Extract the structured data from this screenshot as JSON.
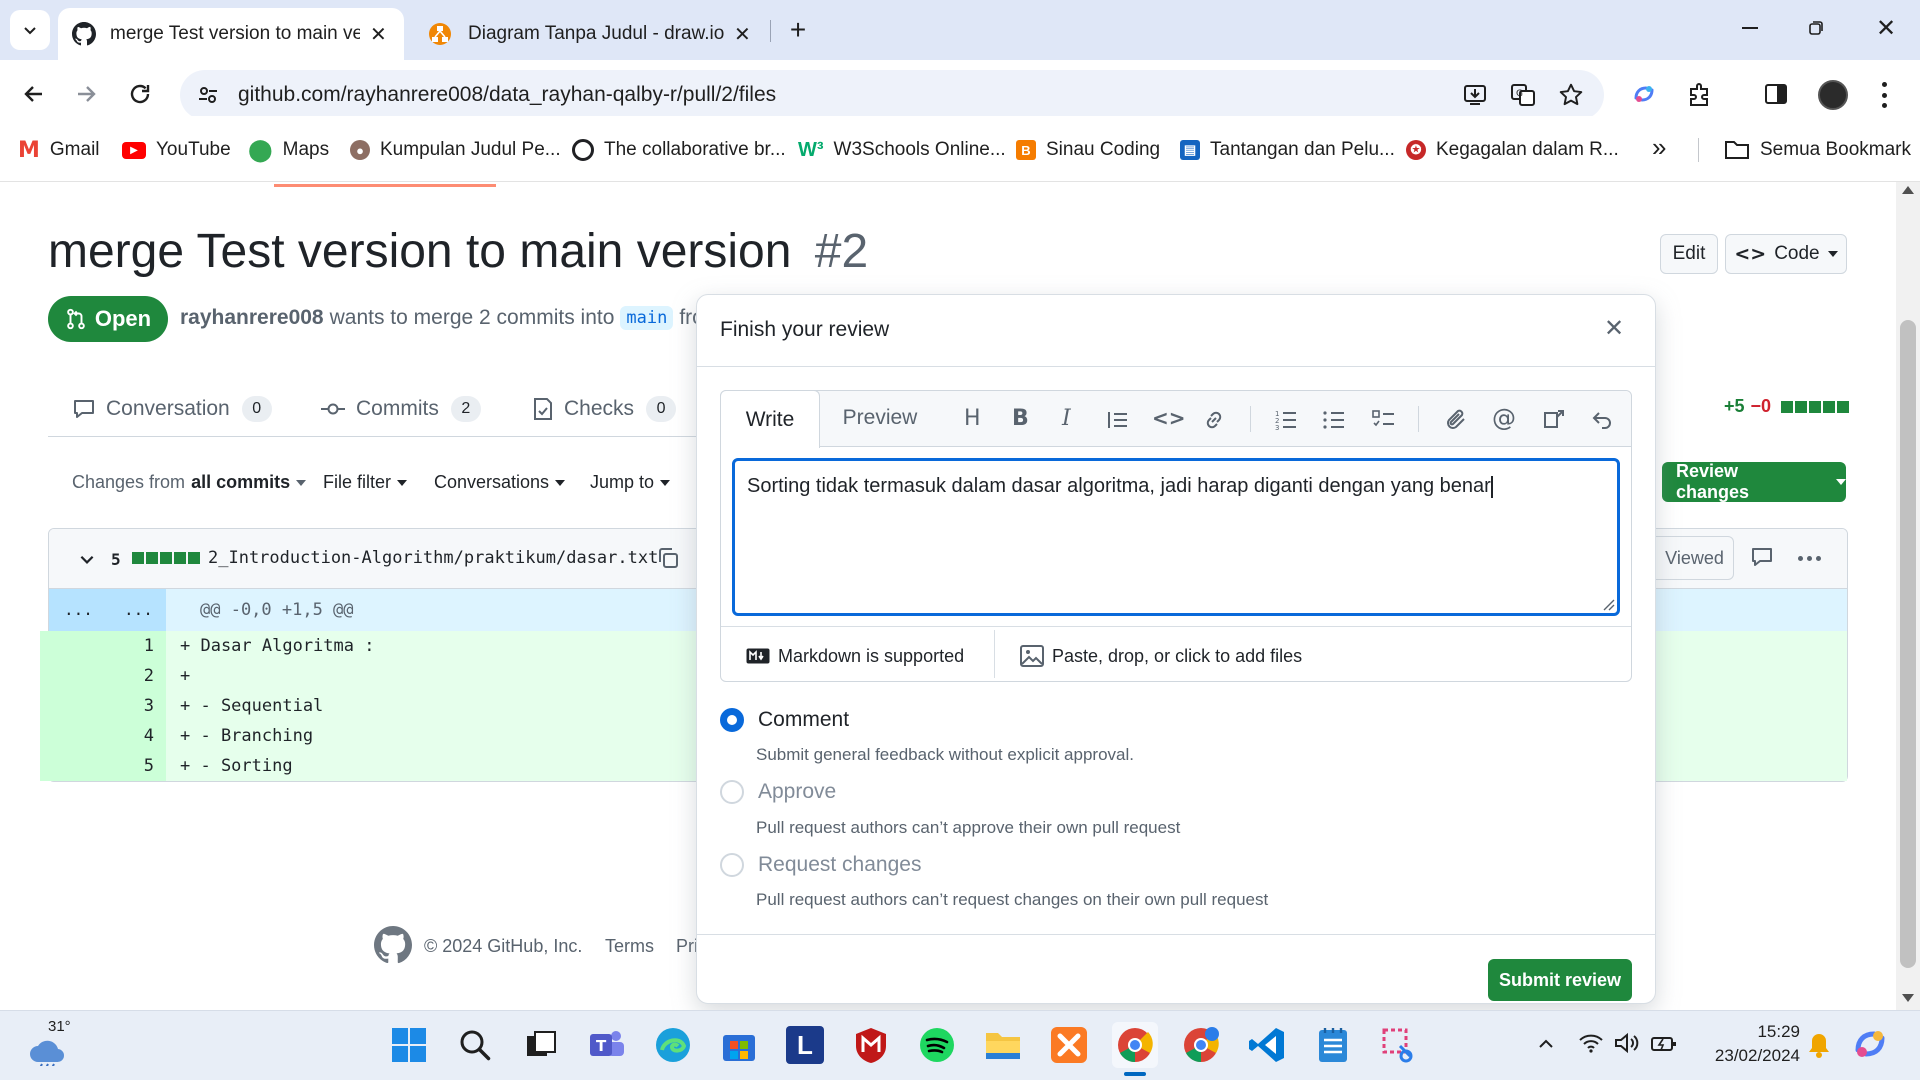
{
  "browser": {
    "tabs": [
      {
        "title": "merge Test version to main vers",
        "active": true
      },
      {
        "title": "Diagram Tanpa Judul - draw.io",
        "active": false
      }
    ],
    "url": "github.com/rayhanrere008/data_rayhan-qalby-r/pull/2/files",
    "bookmarks": [
      {
        "label": "Gmail",
        "icon": "gmail-icon",
        "color": "#ea4335"
      },
      {
        "label": "YouTube",
        "icon": "youtube-icon",
        "color": "#ff0000"
      },
      {
        "label": "Maps",
        "icon": "maps-icon",
        "color": "#34a853"
      },
      {
        "label": "Kumpulan Judul Pe...",
        "icon": "person-icon",
        "color": "#8d6e63"
      },
      {
        "label": "The collaborative br...",
        "icon": "collab-icon",
        "color": "#202124"
      },
      {
        "label": "W3Schools Online...",
        "icon": "w3schools-icon",
        "color": "#04aa6d"
      },
      {
        "label": "Sinau Coding",
        "icon": "blogger-icon",
        "color": "#f57c00"
      },
      {
        "label": "Tantangan dan Pelu...",
        "icon": "doc-icon",
        "color": "#1565c0"
      },
      {
        "label": "Kegagalan dalam R...",
        "icon": "badge-icon",
        "color": "#c62828"
      }
    ],
    "all_bookmarks_label": "Semua Bookmark"
  },
  "pr": {
    "title": "merge Test version to main version",
    "number": "#2",
    "state": "Open",
    "author": "rayhanrere008",
    "merge_text": "wants to merge 2 commits into",
    "base_branch": "main",
    "from_text": "fro",
    "edit_label": "Edit",
    "code_label": "Code",
    "tabs": [
      {
        "label": "Conversation",
        "count": "0",
        "icon": "comment-icon"
      },
      {
        "label": "Commits",
        "count": "2",
        "icon": "commit-icon"
      },
      {
        "label": "Checks",
        "count": "0",
        "icon": "checklist-icon"
      }
    ],
    "diffstat": {
      "added": "+5",
      "removed": "−0"
    },
    "filters": {
      "changes_prefix": "Changes from",
      "changes_value": "all commits",
      "file_filter": "File filter",
      "conversations": "Conversations",
      "jump_to": "Jump to"
    },
    "review_changes_label": "Review changes",
    "file": {
      "changed_count": "5",
      "path": "2_Introduction-Algorithm/praktikum/dasar.txt",
      "viewed_label": "Viewed",
      "hunk_left": "...",
      "hunk_right": "...",
      "hunk_header": "@@ -0,0 +1,5 @@",
      "lines": [
        {
          "num": "1",
          "text": "+ Dasar Algoritma :"
        },
        {
          "num": "2",
          "text": "+"
        },
        {
          "num": "3",
          "text": "+ - Sequential"
        },
        {
          "num": "4",
          "text": "+ - Branching"
        },
        {
          "num": "5",
          "text": "+ - Sorting"
        }
      ]
    },
    "footer": {
      "copyright": "© 2024 GitHub, Inc.",
      "terms": "Terms",
      "privacy": "Pri"
    }
  },
  "review": {
    "title": "Finish your review",
    "write_tab": "Write",
    "preview_tab": "Preview",
    "comment_text": "Sorting tidak termasuk dalam dasar algoritma, jadi harap diganti dengan yang benar",
    "markdown_note": "Markdown is supported",
    "attach_note": "Paste, drop, or click to add files",
    "options": [
      {
        "label": "Comment",
        "desc": "Submit general feedback without explicit approval.",
        "selected": true,
        "disabled": false
      },
      {
        "label": "Approve",
        "desc": "Pull request authors can’t approve their own pull request",
        "selected": false,
        "disabled": true
      },
      {
        "label": "Request changes",
        "desc": "Pull request authors can’t request changes on their own pull request",
        "selected": false,
        "disabled": true
      }
    ],
    "submit_label": "Submit review"
  },
  "taskbar": {
    "weather": "31°",
    "time": "15:29",
    "date": "23/02/2024"
  },
  "colors": {
    "github_green": "#1f883d",
    "github_blue": "#0969da",
    "diff_add_bg": "#e6ffec",
    "diff_add_num_bg": "#ccffd8",
    "chrome_tab_strip": "#dfe7f7"
  }
}
